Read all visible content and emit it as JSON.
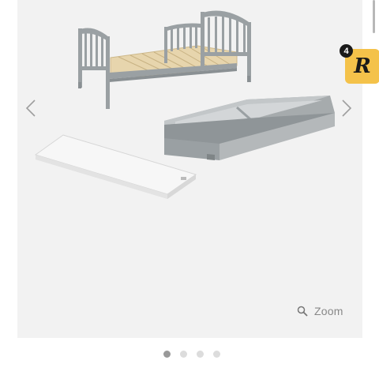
{
  "gallery": {
    "zoom_label": "Zoom",
    "prev_icon": "chevron-left-icon",
    "next_icon": "chevron-right-icon",
    "zoom_icon": "magnifier-icon",
    "current_slide": 1,
    "slides": [
      1,
      2,
      3,
      4
    ]
  },
  "badge": {
    "count": "4",
    "letter": "R",
    "color": "#f4c24a"
  },
  "colors": {
    "product_grey": "#9aa0a3",
    "background": "#f2f2f2"
  }
}
